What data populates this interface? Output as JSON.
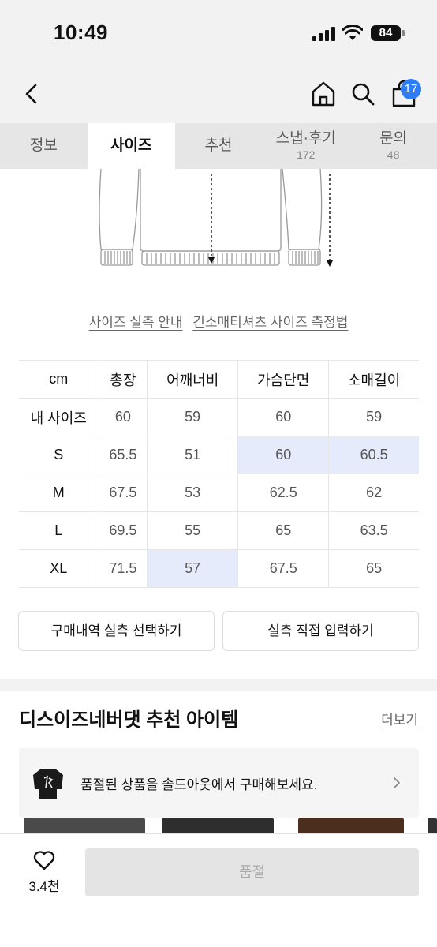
{
  "status_bar": {
    "time": "10:49",
    "battery": "84"
  },
  "header": {
    "cart_count": "17"
  },
  "tabs": [
    {
      "label": "정보",
      "count": ""
    },
    {
      "label": "사이즈",
      "count": ""
    },
    {
      "label": "추천",
      "count": ""
    },
    {
      "label": "스냅·후기",
      "count": "172"
    },
    {
      "label": "문의",
      "count": "48"
    }
  ],
  "active_tab": "사이즈",
  "size_links": {
    "guide": "사이즈 실측 안내",
    "measure": "긴소매티셔츠 사이즈 측정법"
  },
  "size_table": {
    "columns": [
      "cm",
      "총장",
      "어깨너비",
      "가슴단면",
      "소매길이"
    ],
    "rows": [
      {
        "label": "내 사이즈",
        "values": [
          "60",
          "59",
          "60",
          "59"
        ]
      },
      {
        "label": "S",
        "values": [
          "65.5",
          "51",
          "60",
          "60.5"
        ]
      },
      {
        "label": "M",
        "values": [
          "67.5",
          "53",
          "62.5",
          "62"
        ]
      },
      {
        "label": "L",
        "values": [
          "69.5",
          "55",
          "65",
          "63.5"
        ]
      },
      {
        "label": "XL",
        "values": [
          "71.5",
          "57",
          "67.5",
          "65"
        ]
      }
    ],
    "highlight_color": "#e6ebfc"
  },
  "buttons": {
    "purchase_history": "구매내역 실측 선택하기",
    "direct_input": "실측 직접 입력하기"
  },
  "recommend": {
    "title": "디스이즈네버댓 추천 아이템",
    "more": "더보기",
    "soldout_notice": "품절된 상품을 솔드아웃에서 구매해보세요."
  },
  "bottom_bar": {
    "likes": "3.4천",
    "buy_label": "품절"
  },
  "colors": {
    "accent": "#2f7df6",
    "tab_bg": "#e6e6e6",
    "page_bg": "#f2f2f2"
  }
}
